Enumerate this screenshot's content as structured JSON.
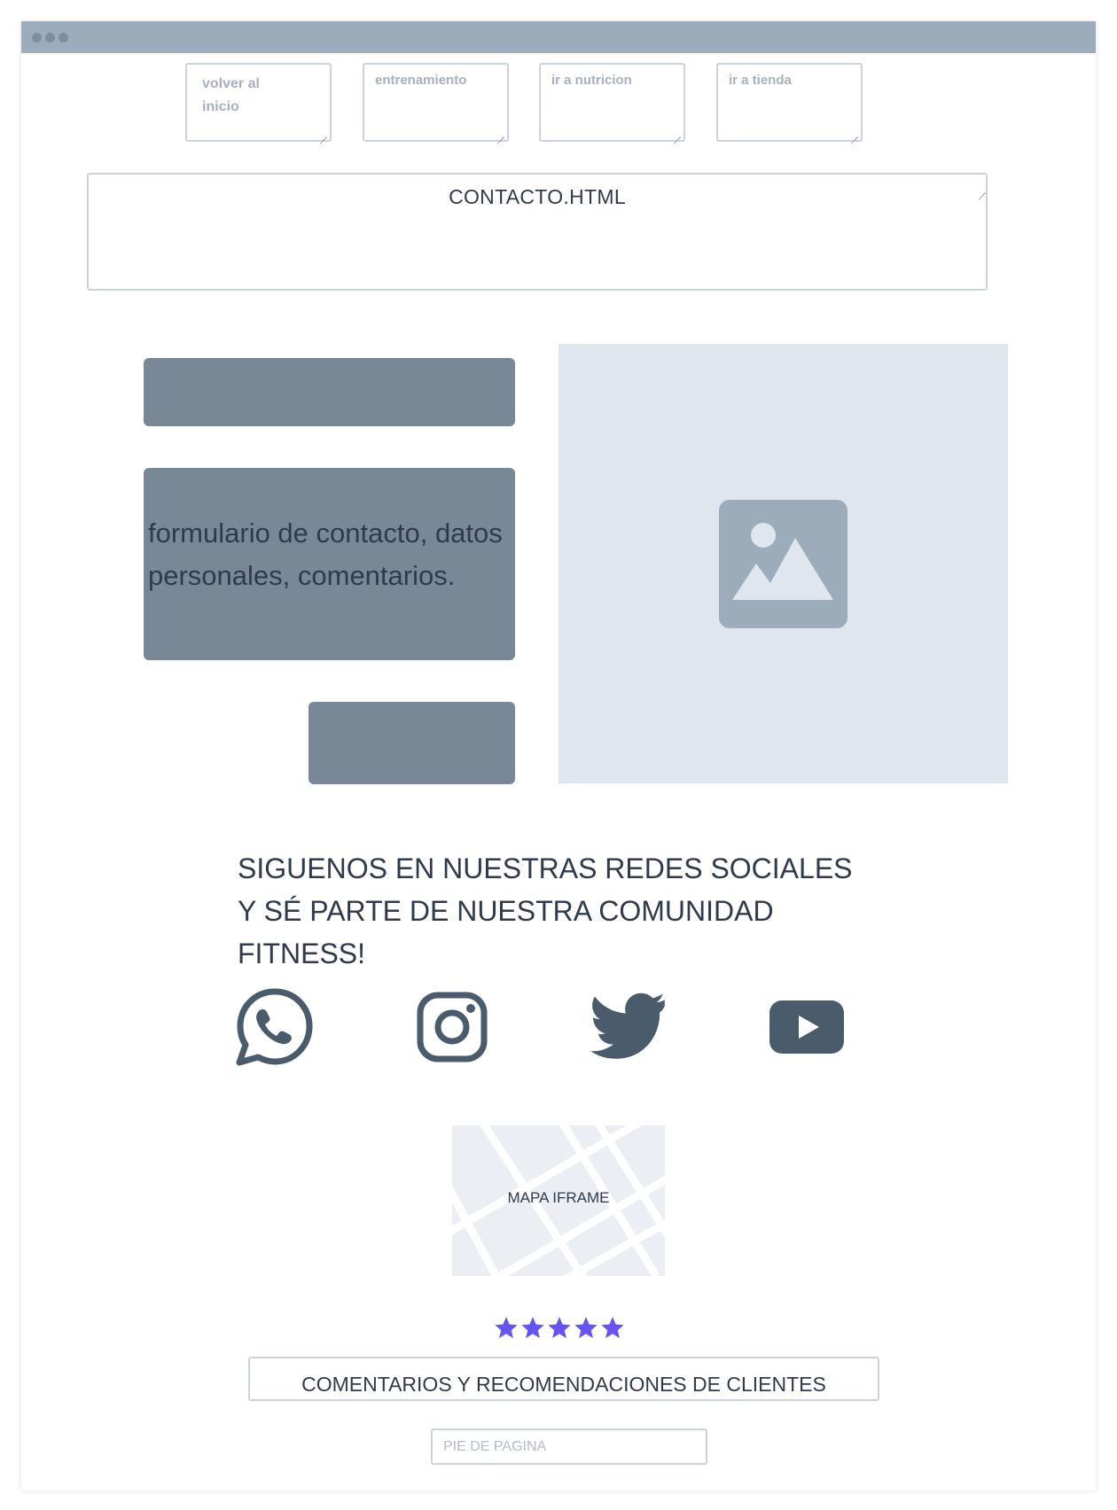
{
  "nav": {
    "items": [
      {
        "label": "volver al inicio"
      },
      {
        "label": "entrenamiento"
      },
      {
        "label": "ir a nutricion"
      },
      {
        "label": "ir a tienda"
      }
    ]
  },
  "page": {
    "title": "CONTACTO.HTML"
  },
  "form": {
    "description": "formulario de contacto, datos personales, comentarios."
  },
  "image": {
    "icon": "image-placeholder-icon"
  },
  "social": {
    "title": "SIGUENOS EN NUESTRAS REDES SOCIALES Y SÉ PARTE DE NUESTRA COMUNIDAD FITNESS!",
    "icons": [
      "whatsapp-icon",
      "instagram-icon",
      "twitter-icon",
      "youtube-icon"
    ]
  },
  "map": {
    "label": "MAPA IFRAME"
  },
  "rating": {
    "stars": 5,
    "max": 5
  },
  "reviews": {
    "label": "COMENTARIOS Y RECOMENDACIONES DE CLIENTES"
  },
  "footer": {
    "placeholder": "PIE DE PAGINA"
  },
  "colors": {
    "titlebar": "#9dacba",
    "block": "#798897",
    "icon": "#4a5b6c",
    "star": "#6554f0",
    "panel": "#e0e6ee"
  }
}
